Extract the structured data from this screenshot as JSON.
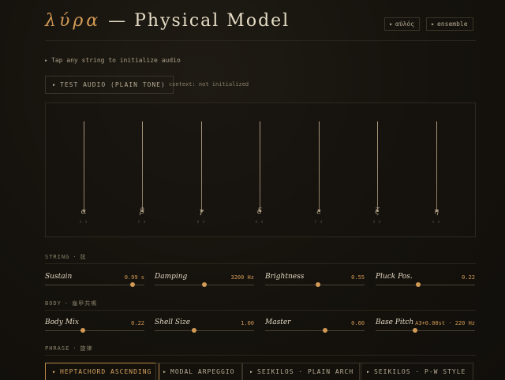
{
  "header": {
    "title_greek": "λύρα",
    "title_rest": "— Physical Model",
    "nav": [
      {
        "label": "αὐλός"
      },
      {
        "label": "ensemble"
      }
    ]
  },
  "hint": "Tap any string to initialize audio",
  "test_button": "TEST AUDIO (PLAIN TONE)",
  "context_status": "context: not initialized",
  "strings": [
    {
      "name": "α",
      "note": "A 3"
    },
    {
      "name": "β",
      "note": "C 4"
    },
    {
      "name": "γ",
      "note": "D 4"
    },
    {
      "name": "δ",
      "note": "E 4"
    },
    {
      "name": "ε",
      "note": "F 4"
    },
    {
      "name": "ζ",
      "note": "G 4"
    },
    {
      "name": "η",
      "note": "A 4"
    }
  ],
  "sections": {
    "string": {
      "label": "STRING",
      "sub": "弦"
    },
    "body": {
      "label": "BODY",
      "sub": "龜甲共鳴"
    },
    "phrase": {
      "label": "PHRASE",
      "sub": "旋律"
    }
  },
  "string_controls": [
    {
      "label": "Sustain",
      "value": "0.99 s",
      "level": 0.88
    },
    {
      "label": "Damping",
      "value": "3200 Hz",
      "level": 0.5
    },
    {
      "label": "Brightness",
      "value": "0.55",
      "level": 0.53
    },
    {
      "label": "Pluck Pos.",
      "value": "0.22",
      "level": 0.43
    }
  ],
  "body_controls": [
    {
      "label": "Body Mix",
      "value": "0.22",
      "level": 0.38
    },
    {
      "label": "Shell Size",
      "value": "1.00",
      "level": 0.4
    },
    {
      "label": "Master",
      "value": "0.60",
      "level": 0.6
    },
    {
      "label": "Base Pitch",
      "value": "A3+0.00st · 220 Hz",
      "level": 0.4
    }
  ],
  "phrases": [
    {
      "label": "HEPTACHORD ASCENDING",
      "active": true
    },
    {
      "label": "MODAL ARPEGGIO",
      "active": false
    },
    {
      "label": "SEIKILOS · PLAIN ARCH",
      "active": false
    },
    {
      "label": "SEIKILOS · P-W STYLE",
      "active": false
    }
  ],
  "colors": {
    "accent": "#d39a55",
    "background": "#15120d",
    "text": "#c9bfa9"
  }
}
